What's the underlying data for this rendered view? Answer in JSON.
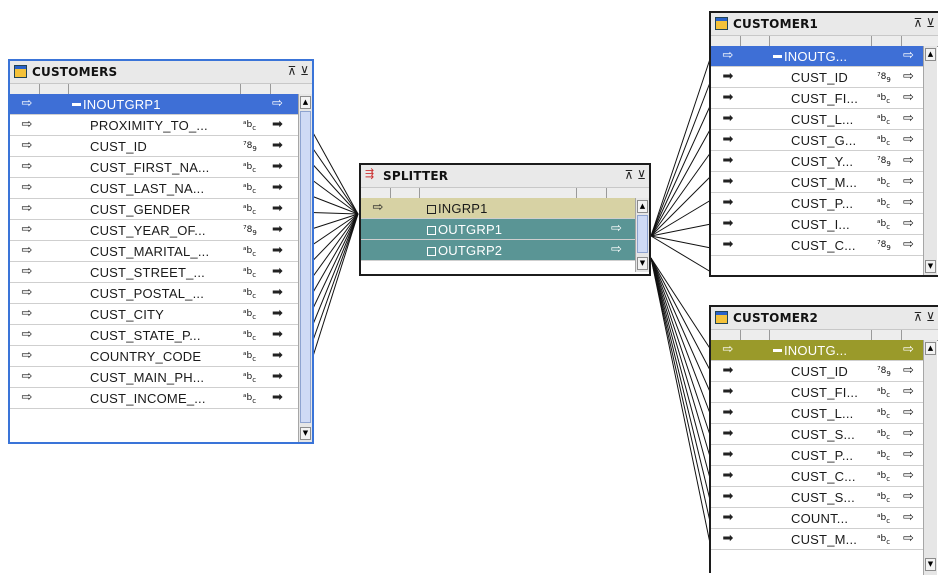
{
  "customers": {
    "title": "CUSTOMERS",
    "group": "INOUTGRP1",
    "rows": [
      {
        "name": "PROXIMITY_TO_...",
        "type": "abc"
      },
      {
        "name": "CUST_ID",
        "type": "789"
      },
      {
        "name": "CUST_FIRST_NA...",
        "type": "abc"
      },
      {
        "name": "CUST_LAST_NA...",
        "type": "abc"
      },
      {
        "name": "CUST_GENDER",
        "type": "abc"
      },
      {
        "name": "CUST_YEAR_OF...",
        "type": "789"
      },
      {
        "name": "CUST_MARITAL_...",
        "type": "abc"
      },
      {
        "name": "CUST_STREET_...",
        "type": "abc"
      },
      {
        "name": "CUST_POSTAL_...",
        "type": "abc"
      },
      {
        "name": "CUST_CITY",
        "type": "abc"
      },
      {
        "name": "CUST_STATE_P...",
        "type": "abc"
      },
      {
        "name": "COUNTRY_CODE",
        "type": "abc"
      },
      {
        "name": "CUST_MAIN_PH...",
        "type": "abc"
      },
      {
        "name": "CUST_INCOME_...",
        "type": "abc"
      }
    ]
  },
  "splitter": {
    "title": "SPLITTER",
    "groups": [
      "INGRP1",
      "OUTGRP1",
      "OUTGRP2"
    ]
  },
  "customer1": {
    "title": "CUSTOMER1",
    "group": "INOUTG...",
    "rows": [
      {
        "name": "CUST_ID",
        "type": "789"
      },
      {
        "name": "CUST_FI...",
        "type": "abc"
      },
      {
        "name": "CUST_L...",
        "type": "abc"
      },
      {
        "name": "CUST_G...",
        "type": "abc"
      },
      {
        "name": "CUST_Y...",
        "type": "789"
      },
      {
        "name": "CUST_M...",
        "type": "abc"
      },
      {
        "name": "CUST_P...",
        "type": "abc"
      },
      {
        "name": "CUST_I...",
        "type": "abc"
      },
      {
        "name": "CUST_C...",
        "type": "789"
      }
    ]
  },
  "customer2": {
    "title": "CUSTOMER2",
    "group": "INOUTG...",
    "rows": [
      {
        "name": "CUST_ID",
        "type": "789"
      },
      {
        "name": "CUST_FI...",
        "type": "abc"
      },
      {
        "name": "CUST_L...",
        "type": "abc"
      },
      {
        "name": "CUST_S...",
        "type": "abc"
      },
      {
        "name": "CUST_P...",
        "type": "abc"
      },
      {
        "name": "CUST_C...",
        "type": "abc"
      },
      {
        "name": "CUST_S...",
        "type": "abc"
      },
      {
        "name": "COUNT...",
        "type": "abc"
      },
      {
        "name": "CUST_M...",
        "type": "abc"
      }
    ]
  },
  "icons": {
    "table": "table-icon",
    "splitter": "splitter-icon",
    "maximize": "maximize-icon",
    "minimize": "minimize-icon",
    "in_port": "in-port-arrow-icon",
    "out_port": "out-port-arrow-icon"
  },
  "colors": {
    "selection": "#3e6fd6",
    "in_group": "#d7d2a4",
    "out_group": "#5a9595",
    "target_group": "#9a9a2a"
  }
}
